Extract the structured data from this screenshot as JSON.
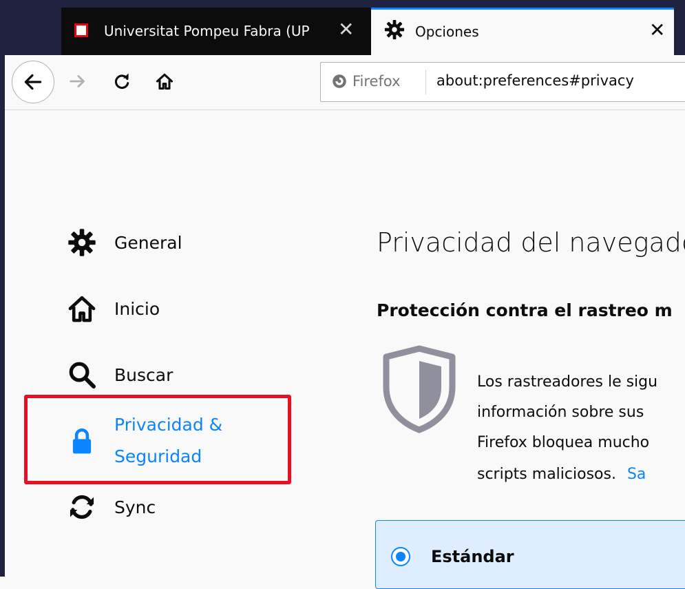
{
  "tabs": [
    {
      "title": "Universitat Pompeu Fabra (UPF)",
      "close": "✕",
      "favicon": "upf-logo-icon"
    },
    {
      "title": "Opciones",
      "close": "✕",
      "favicon": "gear-icon",
      "active": true
    }
  ],
  "navbar": {
    "identity_label": "Firefox",
    "url": "about:preferences#privacy"
  },
  "sidebar": {
    "items": [
      {
        "label": "General",
        "icon": "gear-icon"
      },
      {
        "label": "Inicio",
        "icon": "home-icon"
      },
      {
        "label": "Buscar",
        "icon": "search-icon"
      },
      {
        "label_line1": "Privacidad &",
        "label_line2": "Seguridad",
        "icon": "lock-icon",
        "selected": true
      },
      {
        "label": "Sync",
        "icon": "sync-icon"
      }
    ]
  },
  "main": {
    "title": "Privacidad del navegado",
    "section_title": "Protección contra el rastreo m",
    "description_lines": [
      "Los rastreadores le sigu",
      "información sobre sus",
      "Firefox bloquea mucho",
      "scripts maliciosos."
    ],
    "learn_more": "Sa",
    "standard_label": "Estándar"
  },
  "colors": {
    "accent": "#0a84ff",
    "tabstrip": "#202340",
    "highlight": "#e81123"
  }
}
